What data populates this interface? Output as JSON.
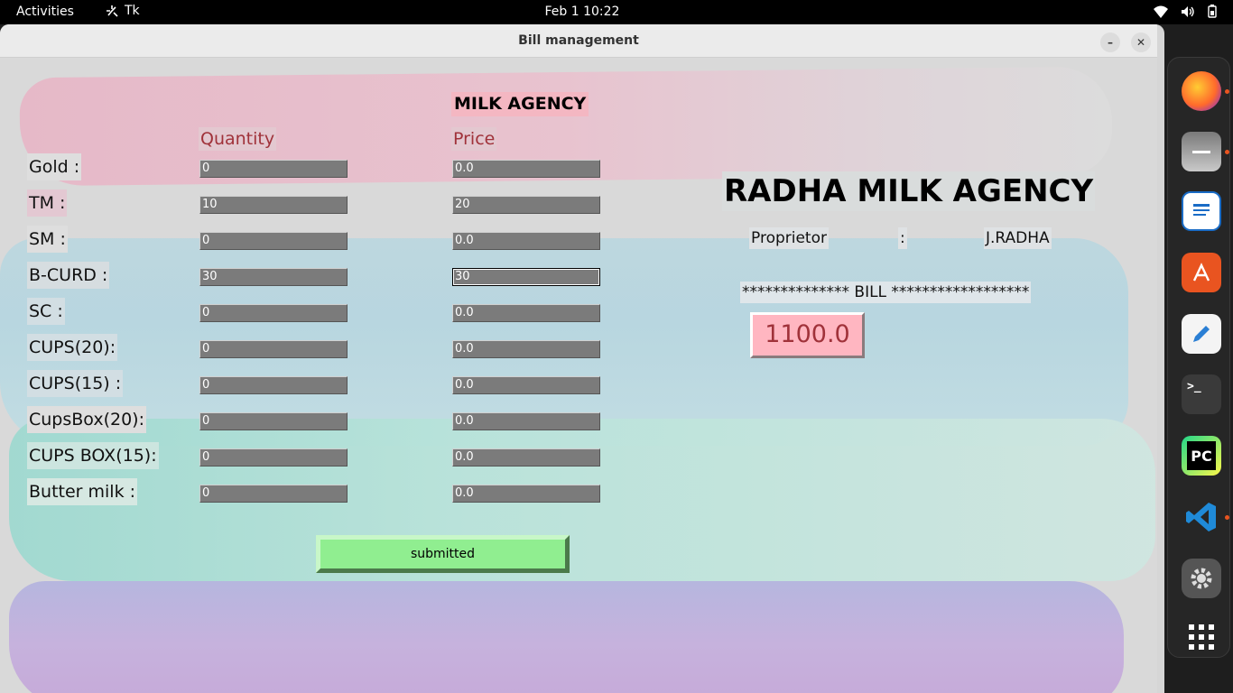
{
  "topbar": {
    "activities": "Activities",
    "app_name": "Tk",
    "clock": "Feb 1  10:22"
  },
  "window": {
    "title": "Bill management",
    "minimize": "–",
    "close": "✕"
  },
  "form": {
    "heading": "MILK AGENCY",
    "quantity_header": "Quantity",
    "price_header": "Price",
    "rows": [
      {
        "label": "Gold :",
        "quantity": "0",
        "price": "0.0"
      },
      {
        "label": "TM    :",
        "quantity": "10",
        "price": "20"
      },
      {
        "label": "SM   :",
        "quantity": "0",
        "price": "0.0"
      },
      {
        "label": "B-CURD    :",
        "quantity": "30",
        "price": "30"
      },
      {
        "label": "SC    :",
        "quantity": "0",
        "price": "0.0"
      },
      {
        "label": "CUPS(20):",
        "quantity": "0",
        "price": "0.0"
      },
      {
        "label": "CUPS(15) :",
        "quantity": "0",
        "price": "0.0"
      },
      {
        "label": "CupsBox(20):",
        "quantity": "0",
        "price": "0.0"
      },
      {
        "label": "CUPS BOX(15):",
        "quantity": "0",
        "price": "0.0"
      },
      {
        "label": "Butter milk :",
        "quantity": "0",
        "price": "0.0"
      }
    ],
    "submit_label": "submitted"
  },
  "bill": {
    "agency_name": "RADHA MILK AGENCY",
    "proprietor_label": "Proprietor",
    "colon": ":",
    "proprietor_name": "J.RADHA",
    "bill_line": "************** BILL ******************",
    "total": "1100.0"
  },
  "dock": {
    "apps": [
      "firefox-icon",
      "files-icon",
      "writer-icon",
      "app-center-icon",
      "text-editor-icon",
      "terminal-icon",
      "pycharm-icon",
      "vscode-icon",
      "settings-icon",
      "show-apps-icon"
    ],
    "pycharm_label": "PC",
    "terminal_label": ">_"
  },
  "colors": {
    "accent_red": "#a0323a",
    "total_bg": "#ffb6c1",
    "submit_bg": "#90ee90",
    "entry_bg": "#7b7b7b"
  }
}
